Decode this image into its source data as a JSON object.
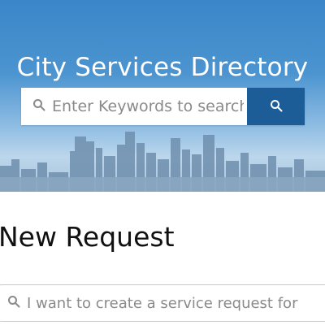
{
  "hero": {
    "title": "City Services Directory",
    "background_image": "city-skyline"
  },
  "search": {
    "placeholder": "Enter Keywords to search",
    "icon": "search-icon",
    "button_icon": "search-icon"
  },
  "new_request": {
    "heading": "New Request",
    "search_placeholder": "I want to create a service request for",
    "icon": "search-icon"
  },
  "colors": {
    "hero_sky": "#3a86c8",
    "search_button": "#1c5d97",
    "heading_text": "#111111",
    "placeholder_text": "#8a8a8a"
  }
}
